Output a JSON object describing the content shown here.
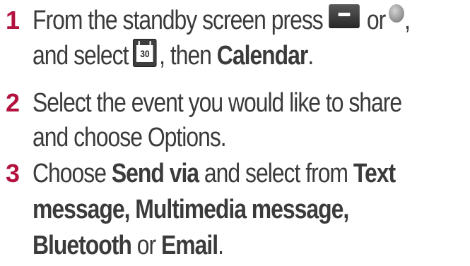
{
  "steps": [
    {
      "number": "1",
      "line1": {
        "t1": "From the standby screen press",
        "t2": "or",
        "t3": ","
      },
      "line2": {
        "t1": "and select",
        "t2": ", then",
        "bold1": "Calendar",
        "t3": "."
      },
      "icons": {
        "key": "menu-key-icon",
        "ball": "ok-key-icon",
        "calendar": "calendar-icon",
        "calendar_date": "30"
      }
    },
    {
      "number": "2",
      "line1": "Select the event you would like to share",
      "line2": "and choose Options."
    },
    {
      "number": "3",
      "line1": {
        "t1": "Choose",
        "bold1": "Send via",
        "t2": "and select from",
        "bold2": "Text"
      },
      "line2": {
        "bold1": "message, Multimedia message,"
      },
      "line3": {
        "bold1": "Bluetooth",
        "t1": "or",
        "bold2": "Email",
        "t2": "."
      }
    }
  ],
  "colors": {
    "number": "#b3123e",
    "text": "#3b3b3b"
  }
}
